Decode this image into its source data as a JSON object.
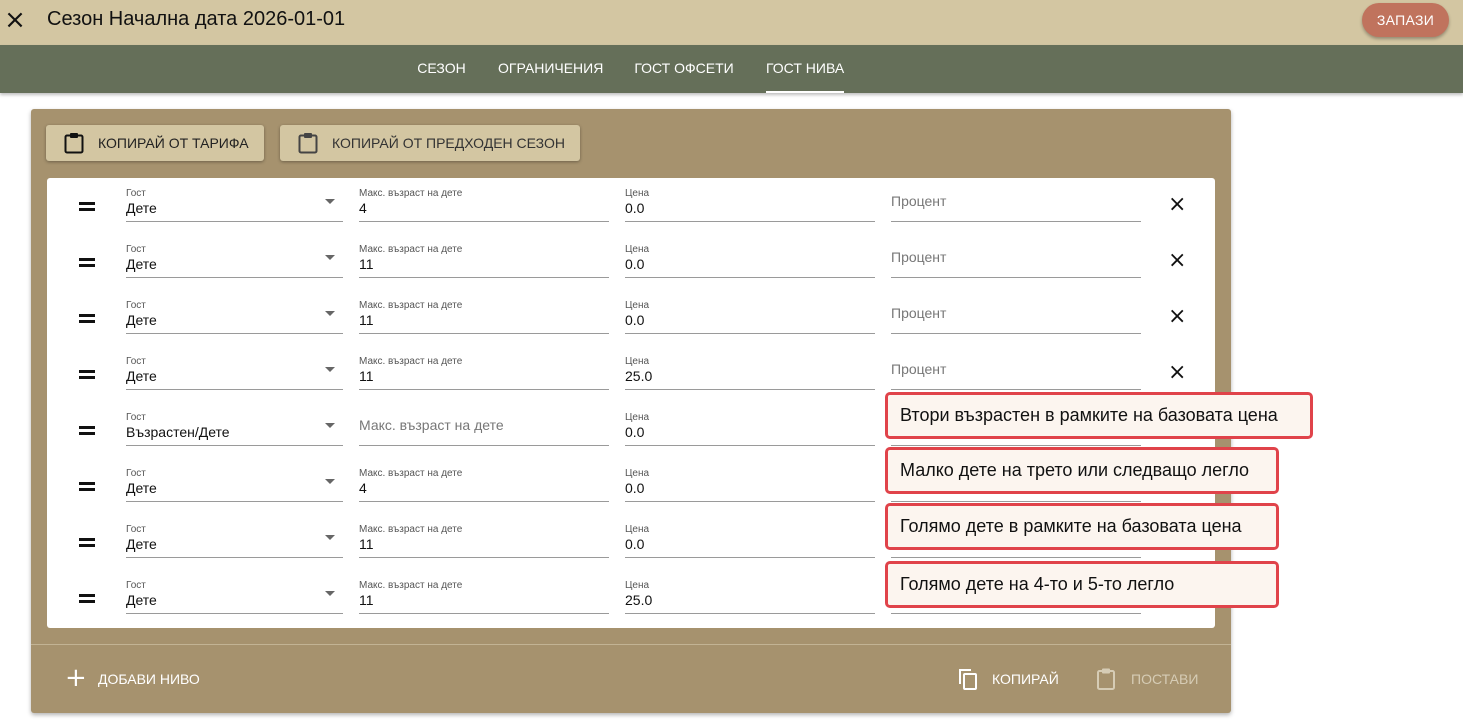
{
  "header": {
    "close_icon": "close-icon",
    "title": "Сезон Начална дата 2026-01-01",
    "save_label": "ЗАПАЗИ",
    "save_color": "#c0735d"
  },
  "tabs": [
    {
      "label": "СЕЗОН",
      "active": false
    },
    {
      "label": "ОГРАНИЧЕНИЯ",
      "active": false
    },
    {
      "label": "ГОСТ ОФСЕТИ",
      "active": false
    },
    {
      "label": "ГОСТ НИВА",
      "active": true
    }
  ],
  "toolbar": {
    "copy_from_tariff": "КОПИРАЙ ОТ ТАРИФА",
    "copy_from_previous": "КОПИРАЙ ОТ ПРЕДХОДЕН СЕЗОН"
  },
  "labels": {
    "guest": "Гост",
    "max_child_age": "Макс. възраст на дете",
    "price": "Цена",
    "percent": "Процент"
  },
  "rows": [
    {
      "guest": "Дете",
      "max_age": "4",
      "price": "0.0",
      "percent": ""
    },
    {
      "guest": "Дете",
      "max_age": "11",
      "price": "0.0",
      "percent": ""
    },
    {
      "guest": "Дете",
      "max_age": "11",
      "price": "0.0",
      "percent": ""
    },
    {
      "guest": "Дете",
      "max_age": "11",
      "price": "25.0",
      "percent": ""
    },
    {
      "guest": "Възрастен/Дете",
      "max_age": "",
      "price": "0.0",
      "percent": ""
    },
    {
      "guest": "Дете",
      "max_age": "4",
      "price": "0.0",
      "percent": ""
    },
    {
      "guest": "Дете",
      "max_age": "11",
      "price": "0.0",
      "percent": ""
    },
    {
      "guest": "Дете",
      "max_age": "11",
      "price": "25.0",
      "percent": ""
    }
  ],
  "footer": {
    "add_level": "ДОБАВИ НИВО",
    "copy": "КОПИРАЙ",
    "paste": "ПОСТАВИ"
  },
  "annotations": [
    "Втори възрастен в рамките на базовата цена",
    "Малко дете на трето или следващо легло",
    "Голямо дете в рамките на базовата цена",
    "Голямо дете на 4-то и 5-то легло"
  ],
  "colors": {
    "header_bg": "#d3c6a2",
    "tabbar_bg": "#656f59",
    "card_bg": "#a6926e",
    "callout_border": "#e0434a"
  }
}
